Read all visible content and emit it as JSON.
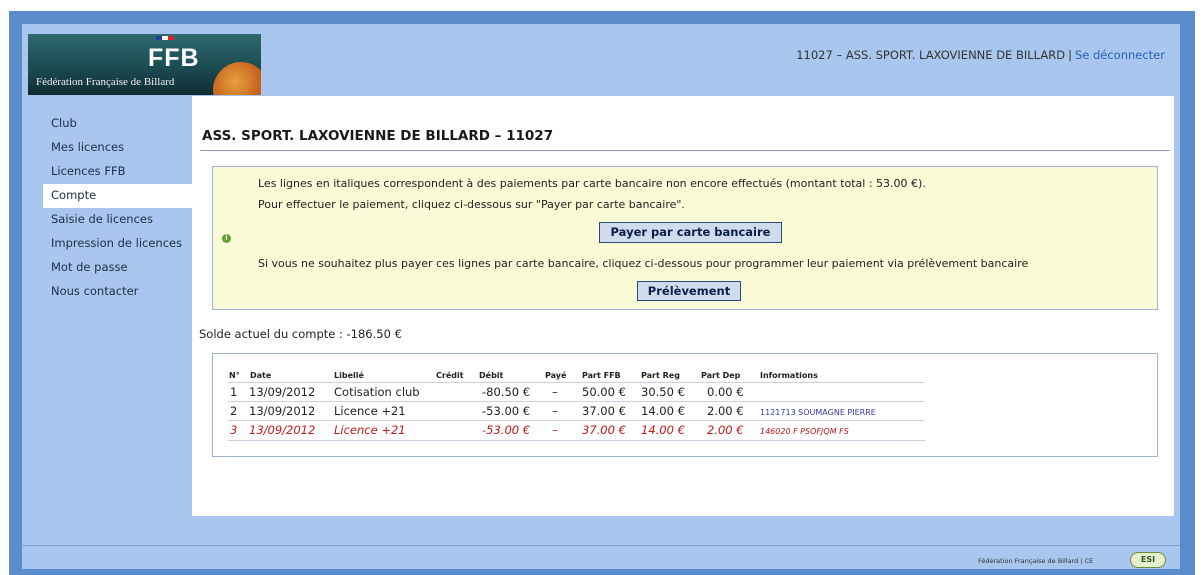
{
  "header": {
    "logo_text": "FFB",
    "logo_subtitle": "Fédération Française de Billard",
    "club_info": "11027 – ASS. SPORT. LAXOVIENNE DE BILLARD",
    "separator": "|",
    "logout_label": "Se déconnecter"
  },
  "sidebar": {
    "items": [
      {
        "label": "Club"
      },
      {
        "label": "Mes licences"
      },
      {
        "label": "Licences FFB"
      },
      {
        "label": "Compte"
      },
      {
        "label": "Saisie de licences"
      },
      {
        "label": "Impression de licences"
      },
      {
        "label": "Mot de passe"
      },
      {
        "label": "Nous contacter"
      }
    ]
  },
  "main": {
    "title": "ASS. SPORT. LAXOVIENNE DE BILLARD – 11027",
    "notice": {
      "line1": "Les lignes en italiques correspondent à des paiements par carte bancaire non encore effectués  (montant total : 53.00 €).",
      "line2": "Pour effectuer le paiement, cliquez ci-dessous sur \"Payer par carte bancaire\".",
      "pay_button": "Payer par carte bancaire",
      "line3": "Si vous ne souhaitez plus payer ces lignes par carte bancaire, cliquez ci-dessous pour programmer leur paiement via prélèvement bancaire",
      "debit_button": "Prélèvement"
    },
    "balance": "Solde actuel du compte : -186.50 €",
    "table": {
      "headers": [
        "N°",
        "Date",
        "Libellé",
        "Crédit",
        "Débit",
        "Payé",
        "Part FFB",
        "Part Reg",
        "Part Dep",
        "Informations"
      ],
      "rows": [
        {
          "num": "1",
          "date": "13/09/2012",
          "label": "Cotisation club",
          "credit": "",
          "debit": "-80.50 €",
          "paid": "–",
          "ffb": "50.00 €",
          "reg": "30.50 €",
          "dep": "0.00 €",
          "info": ""
        },
        {
          "num": "2",
          "date": "13/09/2012",
          "label": "Licence +21",
          "credit": "",
          "debit": "-53.00 €",
          "paid": "–",
          "ffb": "37.00 €",
          "reg": "14.00 €",
          "dep": "2.00 €",
          "info": "1121713   SOUMAGNE   PIERRE"
        },
        {
          "num": "3",
          "date": "13/09/2012",
          "label": "Licence +21",
          "credit": "",
          "debit": "-53.00 €",
          "paid": "–",
          "ffb": "37.00 €",
          "reg": "14.00 €",
          "dep": "2.00 €",
          "info": "146020 F   PSOFJQM   FS"
        }
      ]
    }
  },
  "footer": {
    "text": "Fédération Française de Billard | CE",
    "logo": "ESI"
  },
  "colors": {
    "frame": "#5b8ccc",
    "outer_bg": "#a9c7ee",
    "notice_bg": "#fbfad7",
    "italic_row": "#c01818",
    "button_bg": "#cfdcee"
  }
}
